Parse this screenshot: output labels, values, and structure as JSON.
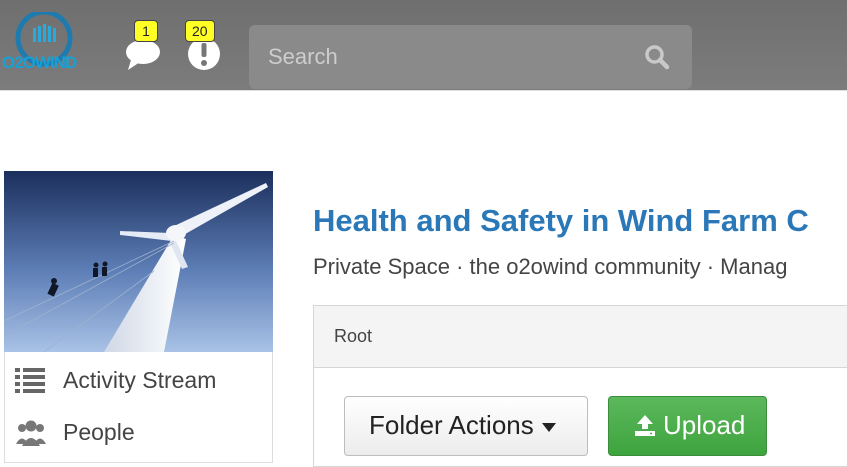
{
  "header": {
    "logo_text": "O2OWIND",
    "messages_badge": "1",
    "notifications_badge": "20",
    "search_placeholder": "Search"
  },
  "sidebar": {
    "items": [
      {
        "label": "Activity Stream",
        "icon": "list-icon"
      },
      {
        "label": "People",
        "icon": "people-icon"
      }
    ]
  },
  "space": {
    "title": "Health and Safety in Wind Farm C",
    "subtitle": "Private Space · the o2owind community · Manag"
  },
  "documents": {
    "breadcrumb": "Root",
    "folder_actions_label": "Folder Actions",
    "upload_label": "Upload"
  },
  "colors": {
    "topbar": "#777777",
    "title": "#2a78b7",
    "upload_green": "#4cae4c",
    "badge_yellow": "#ffff26"
  }
}
